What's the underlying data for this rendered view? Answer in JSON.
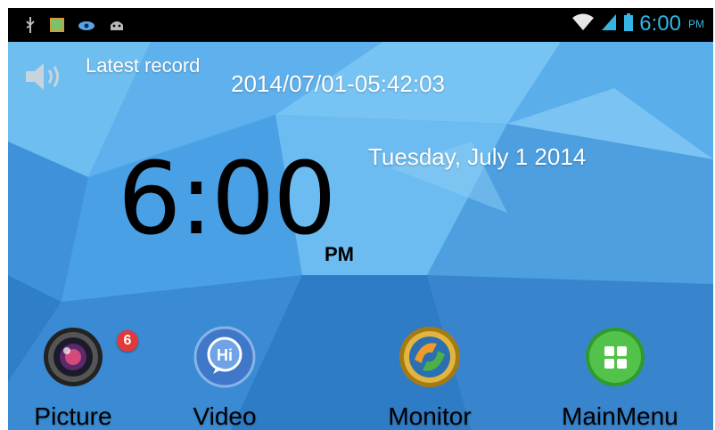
{
  "status_bar": {
    "time": "6:00",
    "ampm": "PM",
    "left_icons": [
      "usb-icon",
      "gallery-icon",
      "sync-icon",
      "android-icon"
    ],
    "right_icons": [
      "wifi-icon",
      "signal-icon",
      "battery-icon"
    ],
    "accent_color": "#33b5e5"
  },
  "header": {
    "latest_label": "Latest record",
    "latest_value": "2014/07/01-05:42:03",
    "speaker_icon": "speaker-icon"
  },
  "clock": {
    "time": "6:00",
    "ampm": "PM",
    "date": "Tuesday, July 1 2014"
  },
  "apps": [
    {
      "label": "Picture",
      "icon": "camera-lens-icon",
      "badge": "6"
    },
    {
      "label": "Video",
      "icon": "hi-chat-icon"
    },
    {
      "label": "Monitor",
      "icon": "monitor-icon"
    },
    {
      "label": "MainMenu",
      "icon": "grid-menu-icon"
    }
  ]
}
